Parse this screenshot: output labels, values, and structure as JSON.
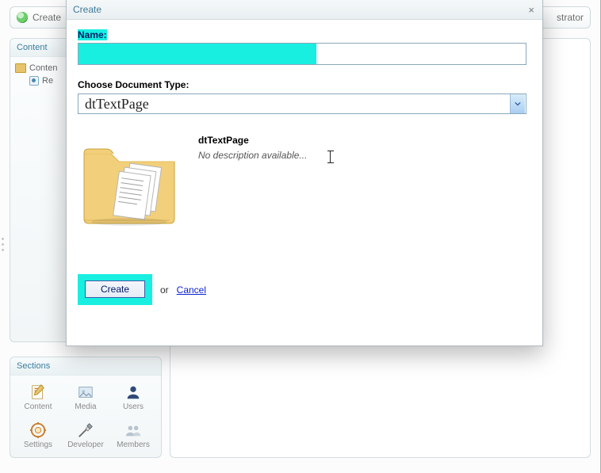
{
  "topbar": {
    "left_label": "Create",
    "right_label": "strator"
  },
  "left_panels": {
    "content_title": "Content",
    "tree": {
      "root_label": "Conten",
      "child_label": "Re"
    },
    "sections_title": "Sections",
    "sections": [
      {
        "name": "content",
        "label": "Content"
      },
      {
        "name": "media",
        "label": "Media"
      },
      {
        "name": "users",
        "label": "Users"
      },
      {
        "name": "settings",
        "label": "Settings"
      },
      {
        "name": "developer",
        "label": "Developer"
      },
      {
        "name": "members",
        "label": "Members"
      }
    ]
  },
  "dialog": {
    "title": "Create",
    "name_label": "Name:",
    "name_value": "",
    "type_label": "Choose Document Type:",
    "type_value": "dtTextPage",
    "preview": {
      "title": "dtTextPage",
      "subtitle": "No description available..."
    },
    "actions": {
      "create": "Create",
      "or": "or",
      "cancel": "Cancel"
    }
  }
}
